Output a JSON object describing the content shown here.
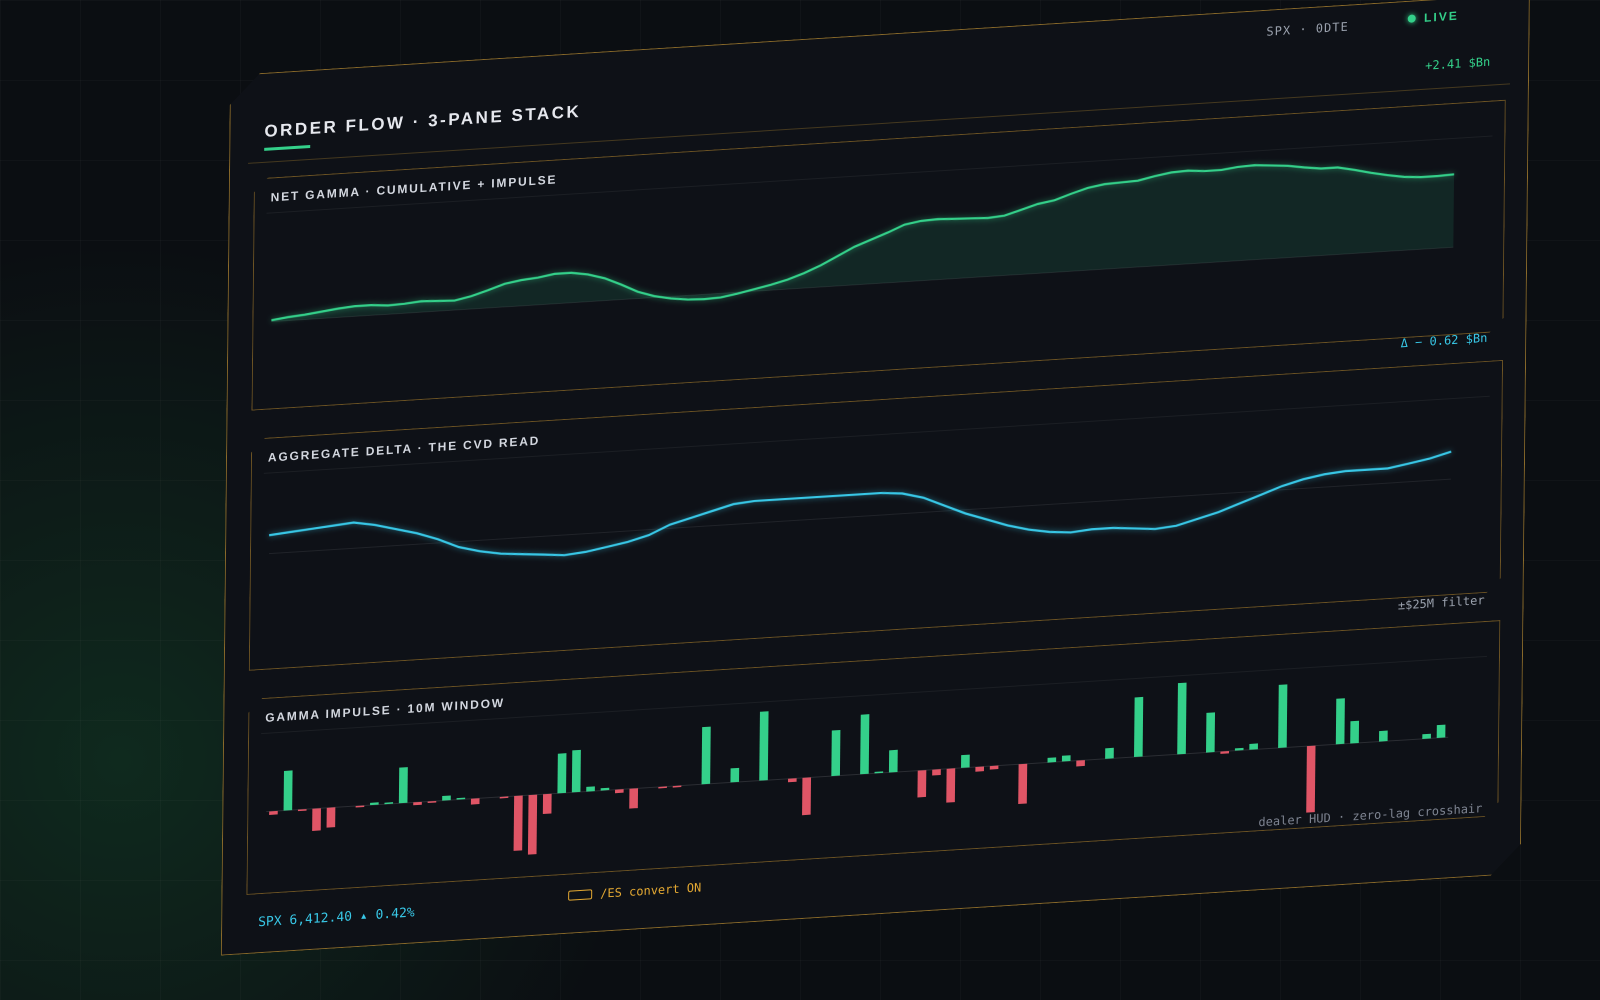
{
  "header": {
    "title": "ORDER FLOW · 3-PANE STACK",
    "symbol": "SPX · 0DTE",
    "live": "LIVE"
  },
  "colors": {
    "accent_green": "#34d08a",
    "accent_cyan": "#38c7e6",
    "negative_red": "#e05566",
    "frame_gold": "#8a6a2a",
    "warning_amber": "#e3a832"
  },
  "panes": {
    "gamma": {
      "title": "NET GAMMA · CUMULATIVE + IMPULSE",
      "readout": "+2.41 $Bn"
    },
    "delta": {
      "title": "AGGREGATE DELTA · THE CVD READ",
      "readout": "Δ − 0.62 $Bn"
    },
    "impulse": {
      "title": "GAMMA IMPULSE · 10M WINDOW",
      "readout": "±$25M filter"
    }
  },
  "footer": {
    "price": "SPX 6,412.40 ▴ 0.42%",
    "es_convert": "/ES convert ON",
    "hud": "dealer HUD · zero-lag crosshair"
  },
  "icons": {
    "live": "status-dot-icon",
    "keyboard": "keyboard-icon"
  },
  "chart_data": [
    {
      "type": "area",
      "series": [
        {
          "values": [
            0.02,
            0.05,
            0.07,
            0.1,
            0.13,
            0.15,
            0.15,
            0.13,
            0.14,
            0.16,
            0.15,
            0.14,
            0.19,
            0.26,
            0.34,
            0.38,
            0.4,
            0.44,
            0.44,
            0.4,
            0.33,
            0.22,
            0.1,
            0.02,
            -0.03,
            -0.06,
            -0.07,
            -0.06,
            -0.02,
            0.03,
            0.08,
            0.14,
            0.22,
            0.32,
            0.44,
            0.56,
            0.65,
            0.74,
            0.84,
            0.88,
            0.89,
            0.88,
            0.87,
            0.86,
            0.88,
            0.95,
            1.02,
            1.06,
            1.14,
            1.21,
            1.25,
            1.26,
            1.27,
            1.32,
            1.36,
            1.37,
            1.35,
            1.35,
            1.38,
            1.39,
            1.37,
            1.35,
            1.31,
            1.28,
            1.28,
            1.23,
            1.17,
            1.12,
            1.08,
            1.06,
            1.06,
            1.07
          ]
        }
      ]
    },
    {
      "type": "line",
      "series": [
        {
          "values": [
            0.1,
            0.11,
            0.12,
            0.13,
            0.14,
            0.12,
            0.09,
            0.06,
            0.02,
            -0.03,
            -0.06,
            -0.08,
            -0.09,
            -0.1,
            -0.11,
            -0.1,
            -0.08,
            -0.06,
            -0.03,
            0.02,
            0.05,
            0.08,
            0.11,
            0.12,
            0.12,
            0.12,
            0.12,
            0.12,
            0.12,
            0.12,
            0.11,
            0.08,
            0.03,
            -0.02,
            -0.06,
            -0.1,
            -0.13,
            -0.15,
            -0.16,
            -0.15,
            -0.15,
            -0.16,
            -0.17,
            -0.16,
            -0.13,
            -0.1,
            -0.06,
            -0.02,
            0.02,
            0.05,
            0.07,
            0.08,
            0.08,
            0.08,
            0.1,
            0.12,
            0.15
          ]
        }
      ]
    },
    {
      "type": "bar",
      "series": [
        {
          "values": [
            -0.06,
            0.68,
            -0.02,
            -0.38,
            -0.34,
            0,
            -0.02,
            0.04,
            0.02,
            0.61,
            -0.05,
            -0.02,
            0.08,
            0.02,
            -0.1,
            0,
            -0.01,
            -0.94,
            -1.02,
            -0.34,
            0.68,
            0.72,
            0.08,
            0.04,
            -0.06,
            -0.34,
            0,
            -0.02,
            -0.01,
            0,
            0.98,
            0,
            0.24,
            0,
            1.18,
            0,
            -0.06,
            -0.64,
            0,
            0.78,
            0,
            1.02,
            0.02,
            0.38,
            0,
            -0.46,
            -0.1,
            -0.58,
            0.22,
            -0.08,
            -0.06,
            0,
            -0.68,
            0,
            0.08,
            0.1,
            -0.1,
            0,
            0.18,
            0,
            1.02,
            0,
            0,
            1.22,
            0,
            0.68,
            -0.04,
            0.04,
            0.1,
            0,
            1.08,
            0,
            -1.14,
            0,
            0.78,
            0.38,
            0,
            0.18,
            0,
            0,
            0.08,
            0.22
          ]
        }
      ]
    }
  ]
}
